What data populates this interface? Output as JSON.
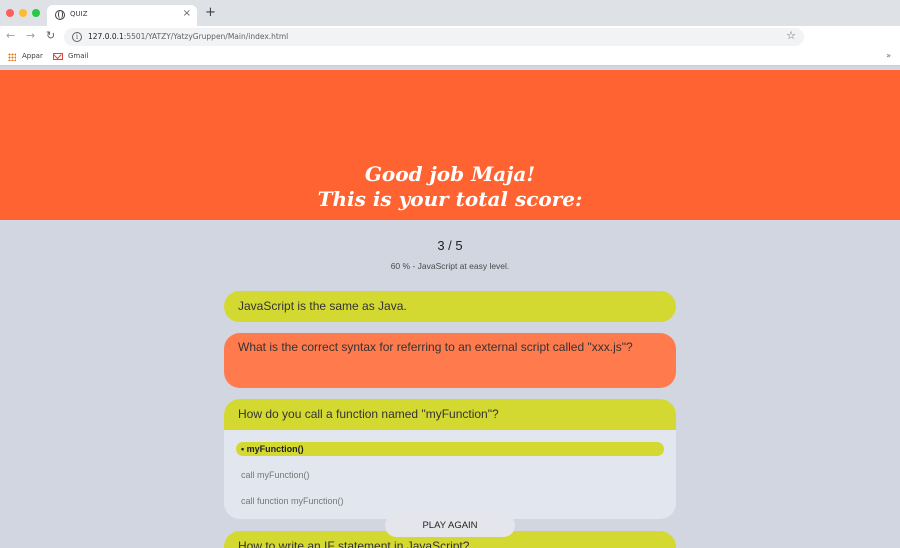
{
  "browser": {
    "tab_title": "QUIZ",
    "tab_close": "×",
    "new_tab": "+",
    "back": "←",
    "forward": "→",
    "reload": "↻",
    "url_host": "127.0.0.1",
    "url_path": ":5501/YATZY/YatzyGruppen/Main/index.html",
    "star": "☆",
    "info": "i",
    "bookmarks": {
      "apps_label": "Appar",
      "gmail_label": "Gmail",
      "more": "»"
    }
  },
  "result": {
    "heading_line1": "Good job Maja!",
    "heading_line2": "This is your total score:",
    "score": "3 / 5",
    "summary": "60 % - JavaScript at easy level."
  },
  "questions": [
    {
      "text": "JavaScript is the same as Java.",
      "status": "correct"
    },
    {
      "text": "What is the correct syntax for referring to an external script called \"xxx.js\"?",
      "status": "wrong"
    },
    {
      "text": "How do you call a function named \"myFunction\"?",
      "status": "correct",
      "options": [
        {
          "text": "• myFunction()",
          "selected": true
        },
        {
          "text": "call myFunction()",
          "selected": false
        },
        {
          "text": "call function myFunction()",
          "selected": false
        }
      ]
    },
    {
      "text": "How to write an IF statement in JavaScript?",
      "status": "correct"
    }
  ],
  "play_again_label": "PLAY AGAIN",
  "colors": {
    "hero": "#ff6331",
    "correct": "#d4d932",
    "wrong": "#ff7a4d",
    "background": "#d1d6e1"
  }
}
